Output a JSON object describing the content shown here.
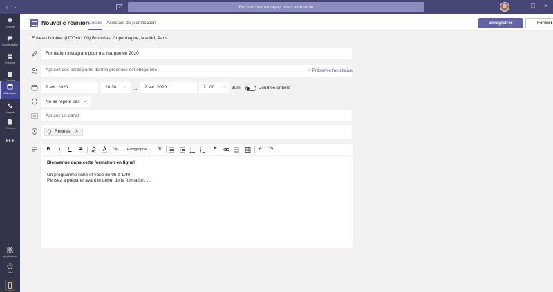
{
  "search": {
    "placeholder": "Recherchez ou tapez une commande"
  },
  "rail": {
    "items": [
      {
        "label": "Activité",
        "icon": "bell-icon"
      },
      {
        "label": "Conversation",
        "icon": "chat-icon"
      },
      {
        "label": "Équipes",
        "icon": "teams-icon"
      },
      {
        "label": "Devoirs",
        "icon": "assignments-icon"
      },
      {
        "label": "Calendrier",
        "icon": "calendar-icon",
        "active": true
      },
      {
        "label": "Appels",
        "icon": "phone-icon"
      },
      {
        "label": "Fichiers",
        "icon": "files-icon"
      }
    ],
    "more": "•••",
    "bottom": [
      {
        "label": "Applications",
        "icon": "apps-icon"
      },
      {
        "label": "Aide",
        "icon": "help-icon"
      }
    ]
  },
  "header": {
    "title": "Nouvelle réunion",
    "tabs": [
      "Détails",
      "Assistant de planification"
    ],
    "save_label": "Enregistrer",
    "close_label": "Fermer"
  },
  "timezone": "Fuseau horaire: (UTC+01:00) Bruxelles, Copenhague, Madrid, Paris",
  "form": {
    "title_value": "Formation Instagram pour ma marque en 2020",
    "attendees_placeholder": "Ajoutez des participants dont la présence est obligatoire",
    "optional_link": "+ Présence facultative",
    "start_date": "2 avr. 2020",
    "start_time": "20:30",
    "end_date": "2 avr. 2020",
    "end_time": "21:00",
    "duration": "30m",
    "all_day_label": "Journée entière",
    "all_day_on": false,
    "repeat_value": "Ne se répète pas",
    "channel_placeholder": "Ajoutez un canal",
    "location_chip": "Rennes",
    "location_remove": "✕"
  },
  "editor": {
    "paragraph_label": "Paragraphe",
    "line1": "Bienvenue dans cette formation en ligne!",
    "line2": "Un programme riche et varié de 9h à 17h!",
    "line3": "Pensez à préparer avant le début de la formation. ..."
  },
  "colors": {
    "accent": "#6264a7",
    "rail": "#33344a",
    "titlebar": "#464775"
  }
}
